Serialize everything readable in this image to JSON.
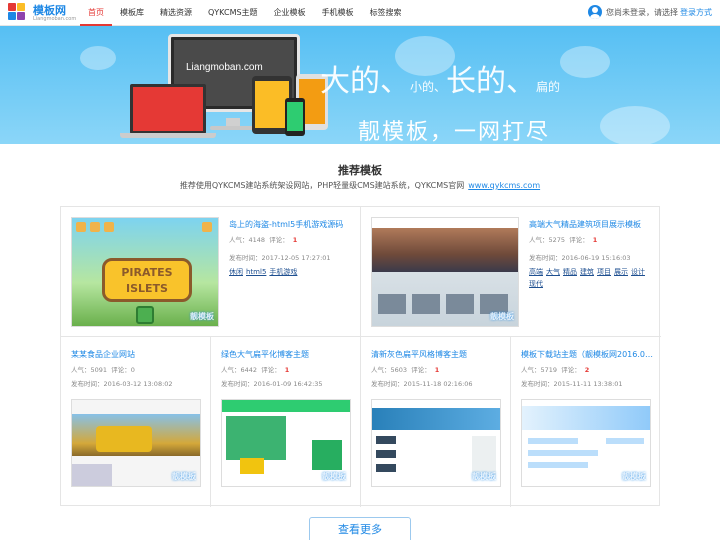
{
  "header": {
    "logo_text": "模板网",
    "logo_sub": "Liangmoban.com",
    "nav": [
      {
        "label": "首页",
        "active": true
      },
      {
        "label": "模板库"
      },
      {
        "label": "精选资源"
      },
      {
        "label": "QYKCMS主题"
      },
      {
        "label": "企业模板"
      },
      {
        "label": "手机模板"
      },
      {
        "label": "标签搜索"
      }
    ],
    "user_text": "您尚未登录，请选择",
    "login_label": "登录方式"
  },
  "banner": {
    "monitor_text": "Liangmoban.com",
    "slogan_big1": "大的、",
    "slogan_small1": "小的、",
    "slogan_big2": "长的、",
    "slogan_small2": "扁的",
    "slogan2": "靓模板，一网打尽"
  },
  "section": {
    "title": "推荐模板",
    "subtitle": "推荐使用QYKCMS建站系统架设网站，PHP轻量级CMS建站系统，QYKCMS官网",
    "link": "www.qykcms.com"
  },
  "cards": [
    {
      "title": "岛上的海盗-html5手机游戏源码",
      "hot_label": "人气：",
      "hot": "4148",
      "comment_label": "评论：",
      "comment": "1",
      "date_label": "发布时间：",
      "date": "2017-12-05 17:27:01",
      "tags": [
        "休闲",
        "html5",
        "手机游戏"
      ]
    },
    {
      "title": "高端大气精品建筑项目展示模板",
      "hot_label": "人气：",
      "hot": "5275",
      "comment_label": "评论：",
      "comment": "1",
      "date_label": "发布时间：",
      "date": "2016-06-19 15:16:03",
      "tags": [
        "高端",
        "大气",
        "精品",
        "建筑",
        "项目",
        "展示",
        "设计",
        "现代"
      ]
    },
    {
      "title": "某某食品企业网站",
      "hot_label": "人气：",
      "hot": "5091",
      "comment_label": "评论：",
      "comment": "0",
      "date_label": "发布时间：",
      "date": "2016-03-12 13:08:02"
    },
    {
      "title": "绿色大气扁平化博客主题",
      "hot_label": "人气：",
      "hot": "6442",
      "comment_label": "评论：",
      "comment": "1",
      "date_label": "发布时间：",
      "date": "2016-01-09 16:42:35"
    },
    {
      "title": "清新灰色扁平风格博客主题",
      "hot_label": "人气：",
      "hot": "5603",
      "comment_label": "评论：",
      "comment": "1",
      "date_label": "发布时间：",
      "date": "2015-11-18 02:16:06"
    },
    {
      "title": "模板下载站主题（靓模板网2016.0…",
      "hot_label": "人气：",
      "hot": "5719",
      "comment_label": "评论：",
      "comment": "2",
      "date_label": "发布时间：",
      "date": "2015-11-11 13:38:01"
    }
  ],
  "watermark": "靓模板",
  "more_label": "查看更多"
}
